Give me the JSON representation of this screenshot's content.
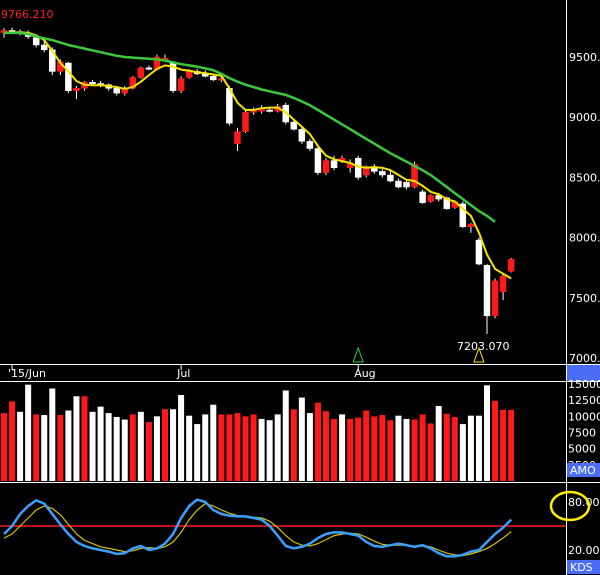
{
  "chart_data": [
    {
      "type": "candlestick",
      "panel": "price",
      "title": "",
      "high_label": "9766.210",
      "low_label": "7203.070",
      "ylim": [
        6950,
        10000
      ],
      "yticks": [
        {
          "value": 9500,
          "label": "9500."
        },
        {
          "value": 9000,
          "label": "9000."
        },
        {
          "value": 8500,
          "label": "8500."
        },
        {
          "value": 8000,
          "label": "8000."
        },
        {
          "value": 7500,
          "label": "7500."
        },
        {
          "value": 7000,
          "label": "7000."
        }
      ],
      "xticks": [
        {
          "index": 1,
          "label": "'15/Jun"
        },
        {
          "index": 22,
          "label": "Jul"
        },
        {
          "index": 44,
          "label": "Aug"
        }
      ],
      "signal_markers": [
        44,
        59
      ],
      "series": [
        {
          "name": "",
          "role": "candles",
          "ohlc": [
            [
              9700,
              9740,
              9660,
              9720
            ],
            [
              9720,
              9745,
              9690,
              9710
            ],
            [
              9710,
              9730,
              9680,
              9700
            ],
            [
              9700,
              9720,
              9650,
              9670
            ],
            [
              9660,
              9680,
              9580,
              9600
            ],
            [
              9600,
              9650,
              9540,
              9560
            ],
            [
              9560,
              9580,
              9350,
              9380
            ],
            [
              9380,
              9480,
              9350,
              9460
            ],
            [
              9450,
              9460,
              9200,
              9220
            ],
            [
              9220,
              9260,
              9150,
              9240
            ],
            [
              9240,
              9300,
              9220,
              9290
            ],
            [
              9290,
              9310,
              9260,
              9280
            ],
            [
              9280,
              9300,
              9250,
              9270
            ],
            [
              9270,
              9280,
              9220,
              9240
            ],
            [
              9240,
              9260,
              9180,
              9200
            ],
            [
              9200,
              9260,
              9180,
              9240
            ],
            [
              9240,
              9340,
              9230,
              9330
            ],
            [
              9330,
              9420,
              9320,
              9410
            ],
            [
              9410,
              9430,
              9390,
              9400
            ],
            [
              9400,
              9520,
              9390,
              9500
            ],
            [
              9490,
              9520,
              9480,
              9490
            ],
            [
              9450,
              9460,
              9200,
              9220
            ],
            [
              9220,
              9340,
              9200,
              9320
            ],
            [
              9330,
              9400,
              9320,
              9380
            ],
            [
              9380,
              9400,
              9350,
              9360
            ],
            [
              9360,
              9390,
              9330,
              9340
            ],
            [
              9340,
              9350,
              9300,
              9310
            ],
            [
              9310,
              9340,
              9290,
              9320
            ],
            [
              9240,
              9260,
              8930,
              8950
            ],
            [
              8780,
              8910,
              8720,
              8880
            ],
            [
              8880,
              9060,
              8870,
              9040
            ],
            [
              9040,
              9080,
              9020,
              9060
            ],
            [
              9050,
              9100,
              9030,
              9070
            ],
            [
              9060,
              9080,
              9040,
              9050
            ],
            [
              9050,
              9110,
              9040,
              9090
            ],
            [
              9100,
              9120,
              8940,
              8960
            ],
            [
              8960,
              8980,
              8890,
              8900
            ],
            [
              8900,
              8920,
              8780,
              8800
            ],
            [
              8800,
              8820,
              8720,
              8740
            ],
            [
              8740,
              8760,
              8520,
              8540
            ],
            [
              8540,
              8660,
              8520,
              8640
            ],
            [
              8640,
              8680,
              8560,
              8580
            ],
            [
              8640,
              8680,
              8620,
              8660
            ],
            [
              8580,
              8650,
              8540,
              8620
            ],
            [
              8660,
              8680,
              8480,
              8500
            ],
            [
              8520,
              8600,
              8500,
              8590
            ],
            [
              8590,
              8610,
              8530,
              8550
            ],
            [
              8550,
              8570,
              8500,
              8520
            ],
            [
              8520,
              8560,
              8460,
              8470
            ],
            [
              8470,
              8490,
              8410,
              8420
            ],
            [
              8460,
              8480,
              8400,
              8420
            ],
            [
              8420,
              8630,
              8410,
              8610
            ],
            [
              8380,
              8400,
              8280,
              8290
            ],
            [
              8300,
              8360,
              8290,
              8350
            ],
            [
              8350,
              8370,
              8300,
              8320
            ],
            [
              8330,
              8340,
              8230,
              8240
            ],
            [
              8250,
              8310,
              8240,
              8300
            ],
            [
              8280,
              8300,
              8080,
              8090
            ],
            [
              8090,
              8120,
              8040,
              8110
            ],
            [
              7980,
              8000,
              7770,
              7780
            ],
            [
              7770,
              7780,
              7200,
              7350
            ],
            [
              7350,
              7660,
              7330,
              7640
            ],
            [
              7550,
              7700,
              7480,
              7680
            ],
            [
              7720,
              7830,
              7710,
              7820
            ]
          ]
        },
        {
          "name": "",
          "role": "short-ma",
          "color": "#f5e400",
          "values": [
            9700,
            9705,
            9705,
            9700,
            9680,
            9640,
            9550,
            9450,
            9380,
            9300,
            9270,
            9265,
            9265,
            9260,
            9250,
            9235,
            9250,
            9295,
            9350,
            9400,
            9430,
            9420,
            9395,
            9385,
            9375,
            9365,
            9355,
            9345,
            9240,
            9120,
            9060,
            9060,
            9075,
            9080,
            9080,
            9040,
            8980,
            8920,
            8860,
            8760,
            8680,
            8650,
            8635,
            8620,
            8590,
            8580,
            8585,
            8580,
            8560,
            8520,
            8480,
            8470,
            8430,
            8380,
            8360,
            8320,
            8300,
            8240,
            8180,
            8040,
            7860,
            7740,
            7700,
            7660
          ]
        },
        {
          "name": "",
          "role": "long-ma",
          "color": "#3cc83c",
          "values": [
            9700,
            9700,
            9700,
            9690,
            9670,
            9655,
            9640,
            9620,
            9600,
            9585,
            9570,
            9555,
            9540,
            9525,
            9510,
            9500,
            9495,
            9490,
            9485,
            9480,
            9470,
            9455,
            9440,
            9430,
            9420,
            9405,
            9390,
            9360,
            9325,
            9295,
            9270,
            9250,
            9230,
            9215,
            9200,
            9185,
            9160,
            9130,
            9100,
            9060,
            9020,
            8980,
            8940,
            8900,
            8860,
            8820,
            8780,
            8740,
            8700,
            8665,
            8630,
            8595,
            8560,
            8520,
            8470,
            8420,
            8370,
            8320,
            8270,
            8220,
            8180,
            8130,
            null,
            8120
          ]
        }
      ]
    },
    {
      "type": "bar",
      "panel": "volume",
      "ylim": [
        0,
        15000
      ],
      "yticks": [
        {
          "value": 15000,
          "label": "15000"
        },
        {
          "value": 12500,
          "label": "12500"
        },
        {
          "value": 10000,
          "label": "10000"
        },
        {
          "value": 7500,
          "label": "7500"
        },
        {
          "value": 5000,
          "label": "5000"
        },
        {
          "value": 2500,
          "label": "2500"
        }
      ],
      "tag": "AMO",
      "series": [
        {
          "name": "",
          "values": [
            10500,
            12300,
            10700,
            14900,
            10300,
            10200,
            14300,
            10200,
            10900,
            13100,
            13100,
            10700,
            11500,
            10500,
            9900,
            9500,
            10300,
            10700,
            9100,
            10000,
            11100,
            11100,
            13300,
            10100,
            8800,
            10300,
            11800,
            10300,
            10300,
            10500,
            10000,
            10300,
            9600,
            9400,
            10300,
            14000,
            11100,
            12900,
            10500,
            12100,
            10800,
            9600,
            10300,
            9600,
            9800,
            10900,
            10000,
            10200,
            9400,
            10100,
            9600,
            9500,
            10300,
            8900,
            11600,
            10400,
            9900,
            8800,
            10100,
            10100,
            14800,
            12400,
            11000,
            11000
          ]
        },
        {
          "name": "",
          "role": "colors",
          "values": [
            "r",
            "r",
            "w",
            "w",
            "r",
            "w",
            "w",
            "r",
            "w",
            "w",
            "r",
            "w",
            "w",
            "w",
            "w",
            "w",
            "r",
            "w",
            "r",
            "w",
            "r",
            "w",
            "w",
            "w",
            "w",
            "w",
            "w",
            "r",
            "r",
            "r",
            "r",
            "r",
            "w",
            "w",
            "w",
            "w",
            "r",
            "w",
            "w",
            "r",
            "r",
            "r",
            "w",
            "r",
            "r",
            "r",
            "r",
            "r",
            "r",
            "w",
            "w",
            "r",
            "r",
            "r",
            "w",
            "r",
            "r",
            "w",
            "w",
            "w",
            "w",
            "r",
            "r",
            "r"
          ]
        }
      ]
    },
    {
      "type": "line",
      "panel": "oscillator",
      "ylim": [
        0,
        100
      ],
      "yticks": [
        {
          "value": 80,
          "label": "80.00"
        },
        {
          "value": 20,
          "label": "20.00"
        }
      ],
      "reference_line": 50,
      "tag": "KDS",
      "series": [
        {
          "name": "",
          "role": "k",
          "color": "#3aa0ff",
          "values": [
            40,
            50,
            65,
            75,
            82,
            78,
            65,
            52,
            40,
            30,
            25,
            22,
            20,
            18,
            15,
            16,
            22,
            25,
            20,
            22,
            28,
            40,
            60,
            75,
            83,
            80,
            70,
            65,
            63,
            62,
            62,
            60,
            58,
            50,
            38,
            25,
            22,
            24,
            28,
            35,
            40,
            42,
            42,
            40,
            38,
            30,
            25,
            24,
            26,
            28,
            26,
            24,
            26,
            22,
            16,
            12,
            12,
            14,
            18,
            20,
            30,
            40,
            48,
            58
          ]
        },
        {
          "name": "",
          "role": "d",
          "color": "#d6c000",
          "values": [
            35,
            40,
            50,
            60,
            70,
            75,
            72,
            64,
            52,
            40,
            32,
            28,
            24,
            22,
            20,
            18,
            19,
            22,
            23,
            22,
            24,
            30,
            42,
            58,
            70,
            78,
            75,
            70,
            66,
            63,
            62,
            61,
            60,
            56,
            48,
            38,
            30,
            26,
            25,
            28,
            33,
            38,
            40,
            41,
            40,
            36,
            31,
            27,
            26,
            26,
            26,
            25,
            25,
            24,
            20,
            16,
            14,
            13,
            15,
            18,
            22,
            28,
            35,
            43
          ]
        }
      ]
    }
  ]
}
